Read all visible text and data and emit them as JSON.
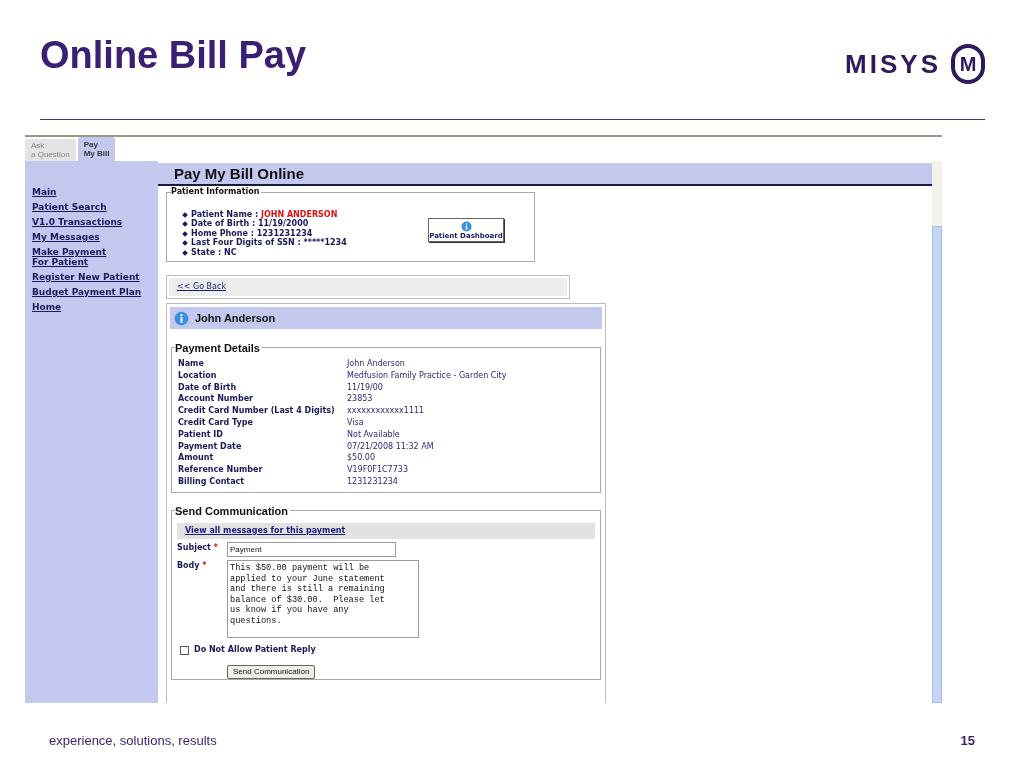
{
  "slide": {
    "title": "Online Bill Pay",
    "logo": {
      "wordmark": "MISYS",
      "mark": "M"
    },
    "footer": "experience, solutions, results",
    "page_number": "15"
  },
  "tabs": [
    {
      "label": [
        "Ask",
        "a Question"
      ],
      "selected": false
    },
    {
      "label": [
        "Pay",
        "My Bill"
      ],
      "selected": true
    }
  ],
  "sidebar": {
    "items": [
      [
        "Main"
      ],
      [
        "Patient Search"
      ],
      [
        "V1.0 Transactions"
      ],
      [
        "My Messages"
      ],
      [
        "Make Payment",
        "For Patient"
      ],
      [
        "Register New Patient"
      ],
      [
        "Budget Payment Plan"
      ],
      [
        "Home"
      ]
    ]
  },
  "page_title": "Pay My Bill Online",
  "patient_information": {
    "legend": "Patient Information",
    "items": [
      {
        "label": "Patient Name :",
        "value": "JOHN ANDERSON",
        "highlight": true
      },
      {
        "label": "Date of Birth :",
        "value": "11/19/2000",
        "highlight": false
      },
      {
        "label": "Home Phone :",
        "value": "1231231234",
        "highlight": false
      },
      {
        "label": "Last Four Digits of SSN :",
        "value": "*****1234",
        "highlight": false
      },
      {
        "label": "State :",
        "value": "NC",
        "highlight": false
      }
    ],
    "dashboard_button": "Patient Dashboard"
  },
  "go_back": "<< Go Back",
  "patient_header": "John Anderson",
  "payment_details": {
    "legend": "Payment Details",
    "rows": [
      {
        "label": "Name",
        "value": "John Anderson"
      },
      {
        "label": "Location",
        "value": "Medfusion Family Practice - Garden City"
      },
      {
        "label": "Date of Birth",
        "value": "11/19/00"
      },
      {
        "label": "Account Number",
        "value": "23853"
      },
      {
        "label": "Credit Card Number (Last 4 Digits)",
        "value": "xxxxxxxxxxxx1111"
      },
      {
        "label": "Credit Card Type",
        "value": "Visa"
      },
      {
        "label": "Patient ID",
        "value": "Not Available"
      },
      {
        "label": "Payment Date",
        "value": "07/21/2008 11:32 AM"
      },
      {
        "label": "Amount",
        "value": "$50.00"
      },
      {
        "label": "Reference Number",
        "value": "V19F0F1C7733"
      },
      {
        "label": "Billing Contact",
        "value": "1231231234"
      }
    ]
  },
  "send_communication": {
    "legend": "Send Communication",
    "view_all_link": "View all messages for this payment",
    "subject": {
      "label": "Subject",
      "required_mark": "*",
      "value": "Payment"
    },
    "body": {
      "label": "Body",
      "required_mark": "*",
      "value": "This $50.00 payment will be\napplied to your June statement\nand there is still a remaining\nbalance of $30.00.  Please let\nus know if you have any\nquestions."
    },
    "no_reply": {
      "label": "Do Not Allow Patient Reply",
      "checked": false
    },
    "send_button": "Send Communication"
  }
}
